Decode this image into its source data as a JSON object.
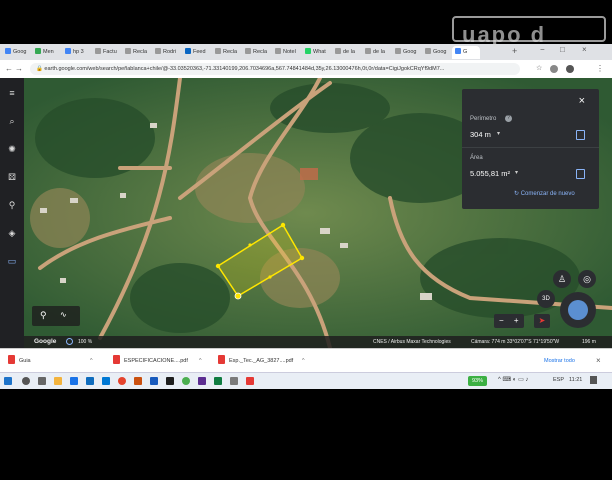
{
  "browser": {
    "tabs": [
      {
        "label": "Goog",
        "color": "#4285f4"
      },
      {
        "label": "Men",
        "color": "#34a853"
      },
      {
        "label": "hp 3",
        "color": "#4285f4"
      },
      {
        "label": "Factu",
        "color": "#999999"
      },
      {
        "label": "Recla",
        "color": "#999999"
      },
      {
        "label": "Rodri",
        "color": "#999999"
      },
      {
        "label": "Feed",
        "color": "#0a66c2"
      },
      {
        "label": "Recla",
        "color": "#999999"
      },
      {
        "label": "Recla",
        "color": "#999999"
      },
      {
        "label": "Notel",
        "color": "#999999"
      },
      {
        "label": "What",
        "color": "#25d366"
      },
      {
        "label": "de la",
        "color": "#999999"
      },
      {
        "label": "de la",
        "color": "#999999"
      },
      {
        "label": "Goog",
        "color": "#999999"
      },
      {
        "label": "Goog",
        "color": "#999999"
      },
      {
        "label": "G",
        "color": "#4285f4"
      }
    ],
    "new_tab": "+",
    "url": "earth.google.com/web/search/peñablanca+chile/@-33.0352036​3,-71.33140199,206.7034696a,567.74841484d,35y,26.13000476h,0t,0r/data=CigiJgokCRqYf9dM7...",
    "back": "←",
    "forward": "→",
    "reload": "C"
  },
  "measure_panel": {
    "close": "×",
    "perimeter_label": "Perímetro",
    "perimeter_value": "304 m",
    "area_label": "Área",
    "area_value": "5.055,81 m²",
    "restart": "Comenzar de nuevo"
  },
  "earth": {
    "logo": "Google",
    "scale": "100 %",
    "attribution": "CNES / Airbus   Maxar Technologies",
    "camera": "Cámara: 774 m   33°02'07\"S 71°19'50\"W",
    "elevation": "196 m",
    "btn_3d": "3D",
    "zoom_minus": "−",
    "zoom_plus": "+"
  },
  "downloads": {
    "items": [
      {
        "name": "Guia"
      },
      {
        "name": "ESPECIFICACIONE....pdf"
      },
      {
        "name": "Esp._Tec._AG_3827....pdf"
      }
    ],
    "show_all": "Mostrar todo",
    "close": "×"
  },
  "taskbar": {
    "battery": "93%",
    "lang": "ESP",
    "time": "11:21"
  },
  "watermark": "uapo d"
}
